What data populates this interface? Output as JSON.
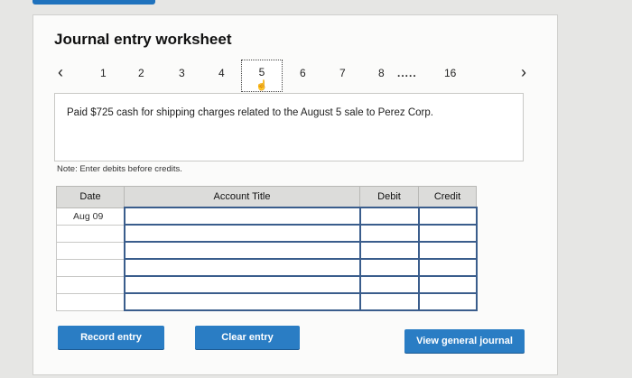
{
  "title": "Journal entry worksheet",
  "pager": {
    "prev_icon": "chevron-left-icon",
    "next_icon": "chevron-right-icon",
    "pages": [
      "1",
      "2",
      "3",
      "4",
      "5",
      "6",
      "7",
      "8"
    ],
    "ellipsis": ".....",
    "last_page": "16",
    "active_page": "5"
  },
  "description": "Paid $725 cash for shipping charges related to the August 5 sale to Perez Corp.",
  "note": "Note: Enter debits before credits.",
  "table": {
    "headers": {
      "date": "Date",
      "account": "Account Title",
      "debit": "Debit",
      "credit": "Credit"
    },
    "rows": [
      {
        "date": "Aug 09",
        "account": "",
        "debit": "",
        "credit": ""
      },
      {
        "date": "",
        "account": "",
        "debit": "",
        "credit": ""
      },
      {
        "date": "",
        "account": "",
        "debit": "",
        "credit": ""
      },
      {
        "date": "",
        "account": "",
        "debit": "",
        "credit": ""
      },
      {
        "date": "",
        "account": "",
        "debit": "",
        "credit": ""
      },
      {
        "date": "",
        "account": "",
        "debit": "",
        "credit": ""
      }
    ]
  },
  "buttons": {
    "record": "Record entry",
    "clear": "Clear entry",
    "view": "View general journal"
  },
  "colors": {
    "accent": "#2a7dc4",
    "header_bg": "#dcdcda",
    "entry_border": "#3a5d8c"
  }
}
